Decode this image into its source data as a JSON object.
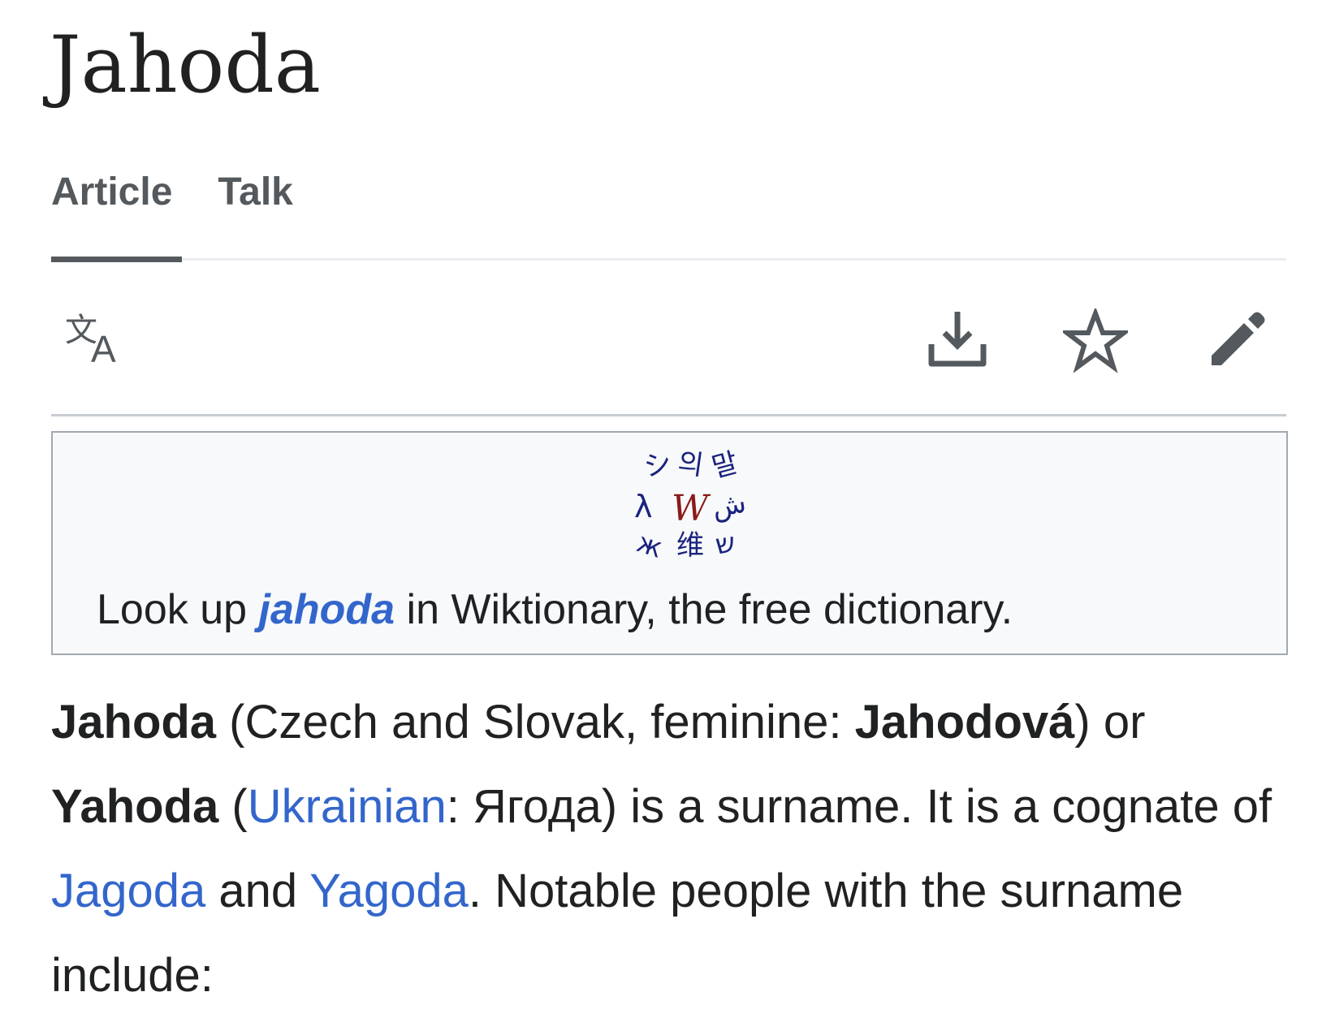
{
  "page": {
    "title": "Jahoda"
  },
  "tabs": [
    {
      "label": "Article",
      "active": true
    },
    {
      "label": "Talk",
      "active": false
    }
  ],
  "toolbar": {
    "icons": [
      "language-icon",
      "download-icon",
      "star-icon",
      "edit-icon"
    ]
  },
  "wiktionary": {
    "prefix": "Look up ",
    "term": "jahoda",
    "suffix": " in Wiktionary, the free dictionary.",
    "logo_glyphs": {
      "r1": [
        "シ",
        "의",
        "말"
      ],
      "r2": [
        "λ",
        "W",
        "ش"
      ],
      "r3": [
        "ж",
        "维",
        "ש"
      ]
    }
  },
  "intro": {
    "s1_name": "Jahoda",
    "s1_paren_open": " (Czech and Slovak, feminine: ",
    "s1_feminine": "Jahodová",
    "s1_paren_close": ") or ",
    "s2_name": "Yahoda",
    "s2_paren_open": " (",
    "s2_link_ukrainian": "Ukrainian",
    "s2_after_link": ": Ягода) is a surname. It is a cognate of ",
    "link_jagoda": "Jagoda",
    "and": " and ",
    "link_yagoda": "Yagoda",
    "tail": ". Notable people with the surname include:"
  },
  "colors": {
    "link": "#3366cc",
    "text": "#202122",
    "icon": "#54595d",
    "box_bg": "#f8f9fa",
    "box_border": "#a2a9b1",
    "logo_main": "#1a237e",
    "logo_w": "#8b1a1a"
  }
}
